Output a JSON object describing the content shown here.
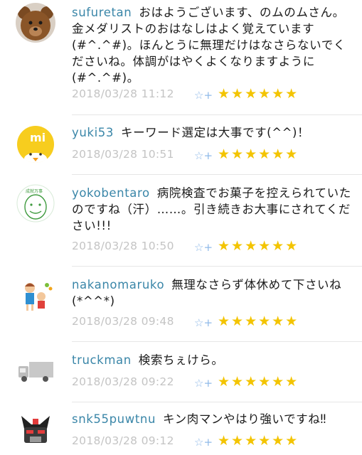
{
  "comments": [
    {
      "user": "sufuretan",
      "text": "おはようございます、のムのムさん。金メダリストのおはなしはよく覚えています(#^.^#)。ほんとうに無理だけはなさらないでくださいね。体調がはやくよくなりますように(#^.^#)。",
      "date": "2018/03/28 11:12",
      "stars": "★★★★★★"
    },
    {
      "user": "yuki53",
      "text": "キーワード選定は大事です(^^)！",
      "date": "2018/03/28 10:51",
      "stars": "★★★★★★"
    },
    {
      "user": "yokobentaro",
      "text": "病院検査でお菓子を控えられていたのですね（汗）……。引き続きお大事にされてください!!!",
      "date": "2018/03/28 10:50",
      "stars": "★★★★★★"
    },
    {
      "user": "nakanomaruko",
      "text": "無理なさらず体休めて下さいね(*^^*)",
      "date": "2018/03/28 09:48",
      "stars": "★★★★★★"
    },
    {
      "user": "truckman",
      "text": "検索ちぇけら。",
      "date": "2018/03/28 09:22",
      "stars": "★★★★★★"
    },
    {
      "user": "snk55puwtnu",
      "text": "キン肉マンやはり強いですね‼",
      "date": "2018/03/28 09:12",
      "stars": "★★★★★★"
    }
  ],
  "icons": {
    "favorite": "☆+"
  },
  "colors": {
    "username": "#3a86a8",
    "date": "#c4c4c4",
    "star": "#f3c400",
    "favorite_icon": "#8fb9e8"
  }
}
